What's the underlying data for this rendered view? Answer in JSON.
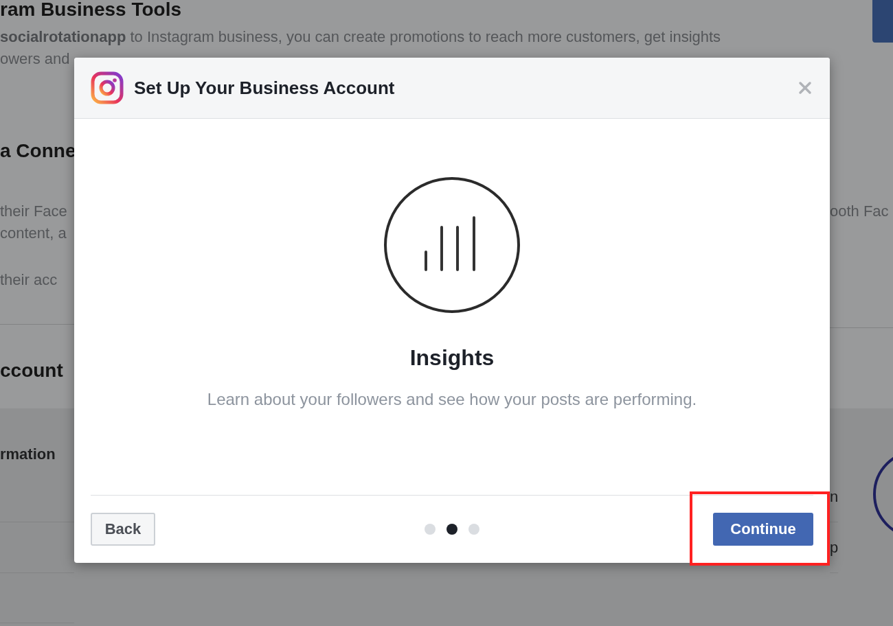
{
  "background_page": {
    "heading": "ram Business Tools",
    "intro": "**socialrotationapp** to Instagram business, you can create promotions to reach more customers, get insights",
    "intro_cont": "owers and",
    "section_heading": "a Conne",
    "section_lines": [
      "their Face",
      "content, a"
    ],
    "section_line_2": "their acc",
    "right_fragment": "ooth Fac",
    "account_heading": "ccount",
    "info_heading": "rmation",
    "right_rows": [
      "n",
      "p"
    ]
  },
  "dialog": {
    "title": "Set Up Your Business Account",
    "feature_title": "Insights",
    "feature_text": "Learn about your followers and see how your posts are performing.",
    "steps": [
      {
        "selected": false
      },
      {
        "selected": true
      },
      {
        "selected": false
      }
    ],
    "back_button": "Back",
    "continue_button": "Continue",
    "continue_highlighted": true
  }
}
